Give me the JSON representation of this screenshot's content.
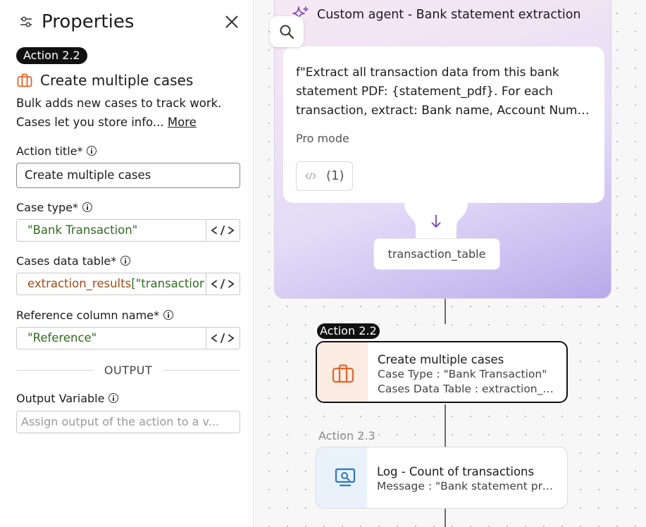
{
  "panel": {
    "title": "Properties",
    "action_badge": "Action 2.2",
    "action_name": "Create multiple cases",
    "description": "Bulk adds new cases to track work. Cases let you store info...",
    "more_link": "More",
    "fields": {
      "action_title": {
        "label": "Action title*",
        "value": "Create multiple cases"
      },
      "case_type": {
        "label": "Case type*",
        "value": "\"Bank Transaction\""
      },
      "cases_data_table": {
        "label": "Cases data table*",
        "value_var": "extraction_results",
        "value_rest": "[\"transaction_table\"]"
      },
      "reference_column": {
        "label": "Reference column name*",
        "value": "\"Reference\""
      }
    },
    "output_section": "OUTPUT",
    "output_variable": {
      "label": "Output Variable",
      "placeholder": "Assign output of the action to a v..."
    }
  },
  "canvas": {
    "agent": {
      "title": "Custom agent - Bank statement extraction",
      "prompt_lines": [
        "f\"Extract all transaction data from this bank",
        "statement PDF: {statement_pdf}. For each",
        "transaction, extract: Bank name, Account Numb..."
      ],
      "mode": "Pro mode",
      "ref_count": "(1)",
      "output": "transaction_table"
    },
    "nodes": [
      {
        "badge": "Action 2.2",
        "title": "Create multiple cases",
        "line2": "Case Type : \"Bank Transaction\"",
        "line3": "Cases Data Table : extraction_r...",
        "icon": "briefcase-icon",
        "selected": true
      },
      {
        "badge": "Action 2.3",
        "title": "Log - Count of transactions",
        "line2": "Message : \"Bank statement pro...",
        "icon": "monitor-search-icon",
        "selected": false
      }
    ]
  },
  "colors": {
    "accent_orange": "#e0662a",
    "accent_blue": "#2a79c4",
    "accent_purple": "#7b3fb4",
    "string_green": "#2f6b1e",
    "variable_brown": "#a54a12"
  }
}
